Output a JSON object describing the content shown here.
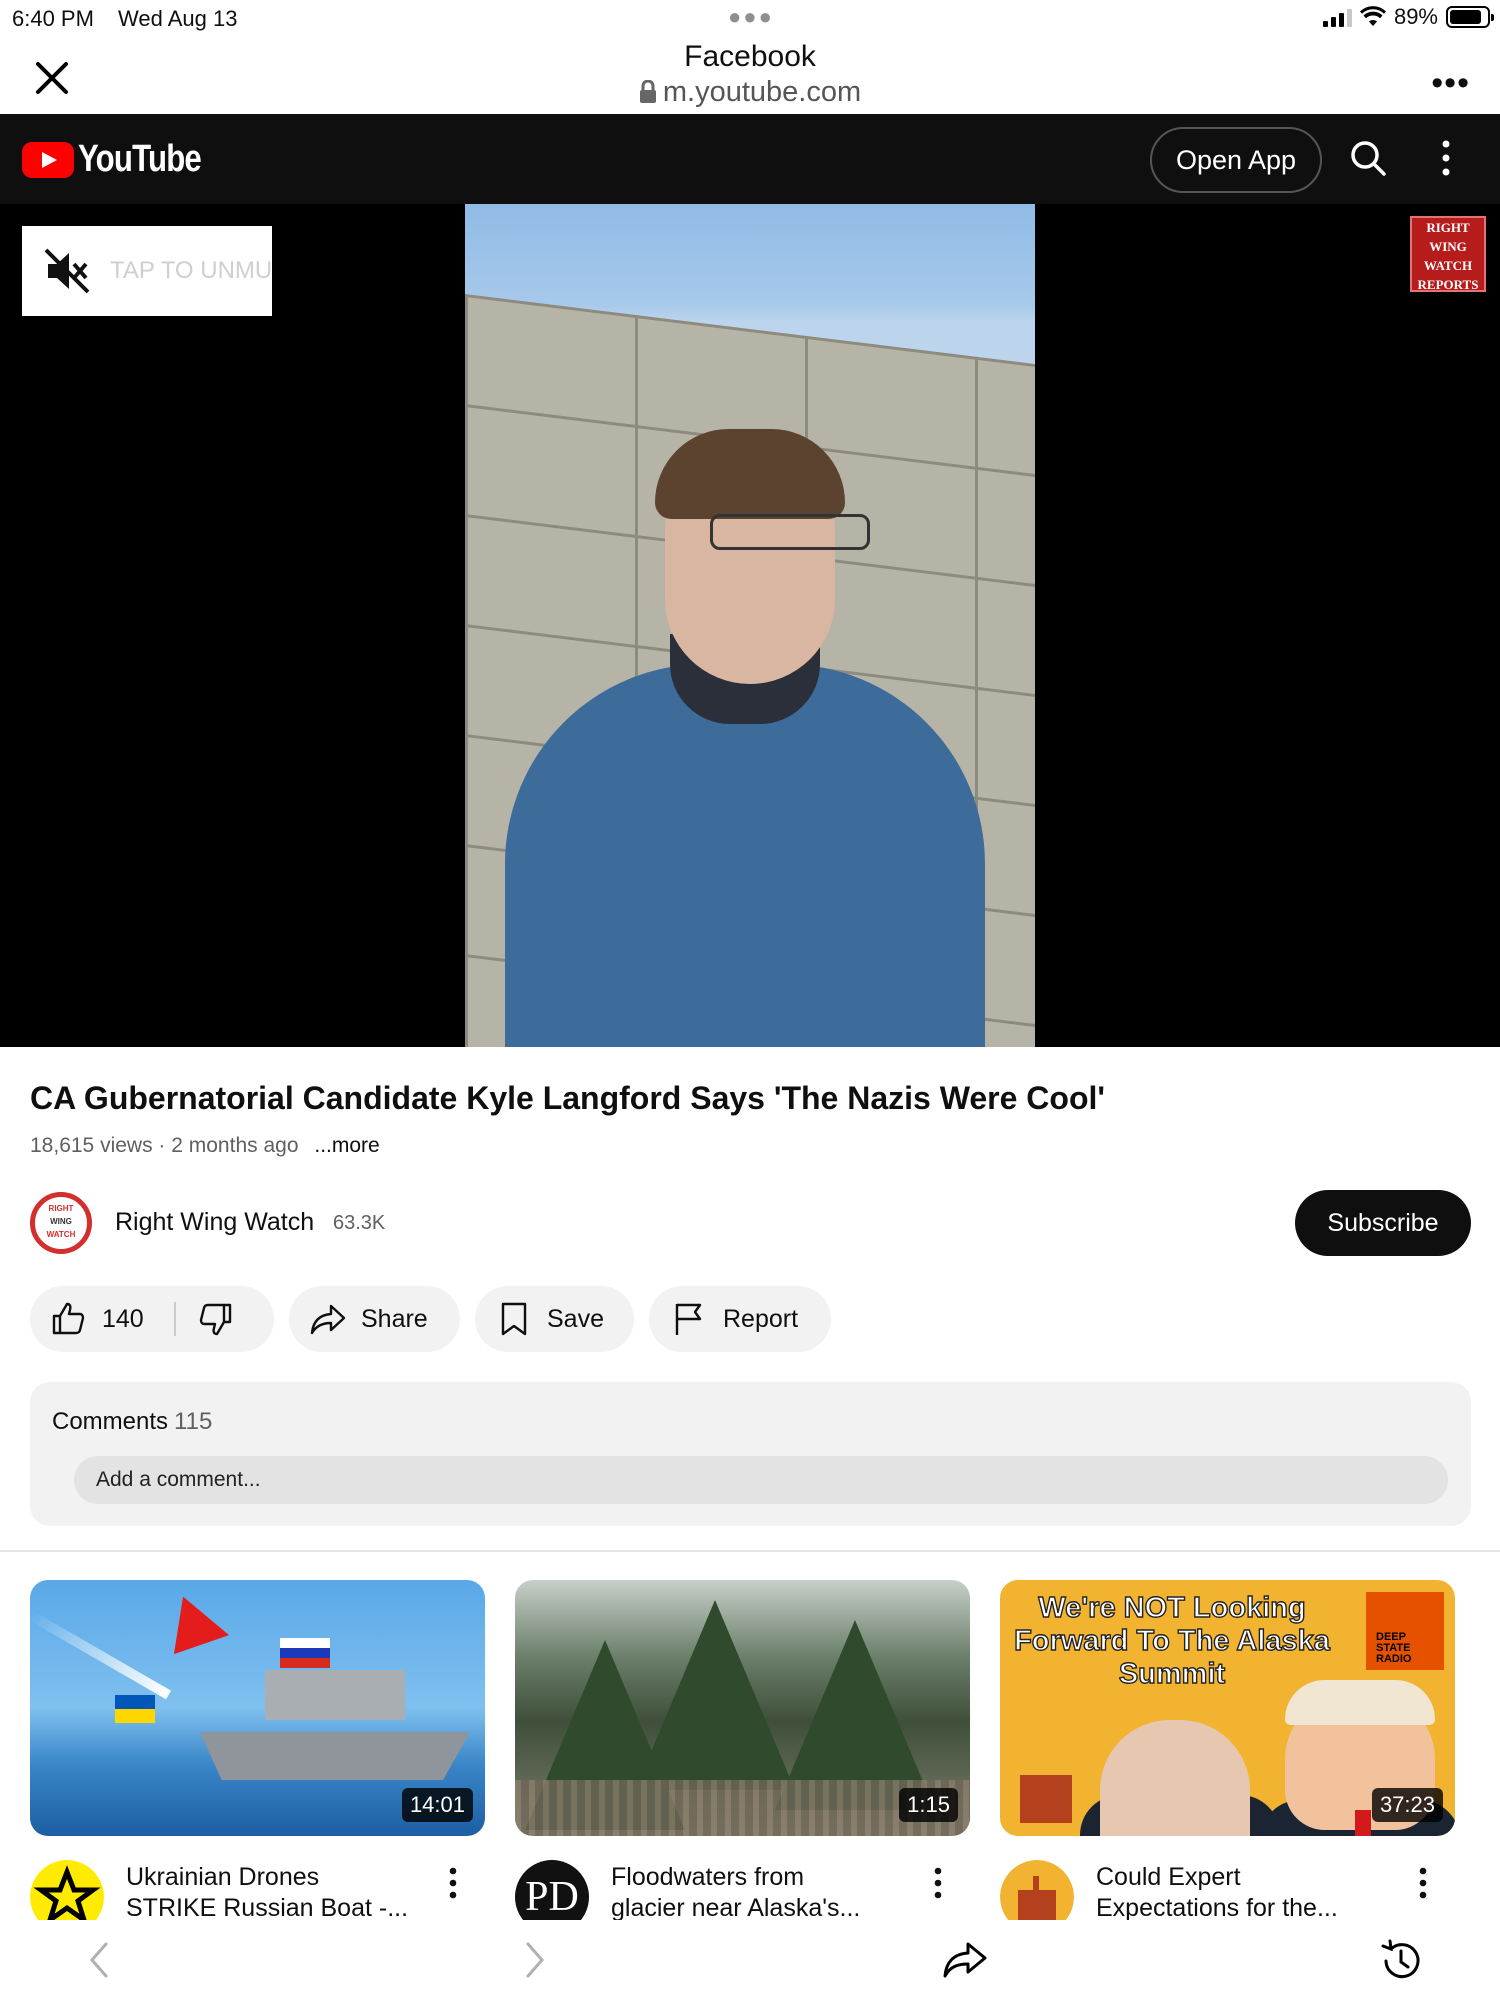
{
  "statusbar": {
    "time": "6:40 PM",
    "date": "Wed Aug 13",
    "battery": "89%",
    "battery_level": 0.89
  },
  "browser": {
    "site_title": "Facebook",
    "url": "m.youtube.com"
  },
  "youtube": {
    "logo_text": "YouTube",
    "open_app_label": "Open App"
  },
  "video": {
    "mute_label": "TAP TO UNMUTE",
    "watermark": [
      "RIGHT",
      "WING",
      "WATCH",
      "REPORTS"
    ],
    "title": "CA Gubernatorial Candidate Kyle Langford Says 'The Nazis Were Cool'",
    "views": "18,615 views",
    "age": "2 months ago",
    "more_label": "...more"
  },
  "channel": {
    "avatar_text": [
      "RIGHT",
      "WING",
      "WATCH"
    ],
    "name": "Right Wing Watch",
    "subscribers": "63.3K",
    "subscribe_label": "Subscribe"
  },
  "actions": {
    "likes": "140",
    "share_label": "Share",
    "save_label": "Save",
    "report_label": "Report"
  },
  "comments": {
    "label": "Comments",
    "count": "115",
    "placeholder": "Add a comment..."
  },
  "recommendations": [
    {
      "title_lines": [
        "Ukrainian Drones",
        "STRIKE Russian Boat -..."
      ],
      "duration": "14:01"
    },
    {
      "title_lines": [
        "Floodwaters from",
        "glacier near Alaska's..."
      ],
      "duration": "1:15",
      "avatar_text": "PD"
    },
    {
      "title_lines": [
        "Could Expert",
        "Expectations for the..."
      ],
      "duration": "37:23",
      "thumb_text": [
        "We're NOT Looking",
        "Forward To The Alaska",
        "Summit"
      ],
      "badge_text": [
        "DEEP",
        "STATE",
        "RADIO"
      ]
    }
  ],
  "icons": {
    "close": "close-icon",
    "lock": "lock-icon",
    "more": "more-horizontal-icon",
    "search": "search-icon",
    "kebab": "more-vertical-icon",
    "mute": "volume-off-icon",
    "like": "thumb-up-icon",
    "dislike": "thumb-down-icon",
    "share": "share-icon",
    "save": "bookmark-icon",
    "report": "flag-icon",
    "back": "chevron-left-icon",
    "forward": "chevron-right-icon",
    "history": "history-icon"
  },
  "colors": {
    "youtube_red": "#ff0000",
    "bar_bg": "#0f0f0f",
    "pill_bg": "#f2f2f2"
  }
}
